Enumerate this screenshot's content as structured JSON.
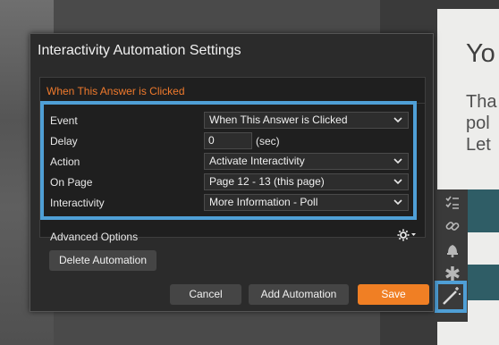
{
  "background": {
    "slide_heading": "Yo",
    "slide_body": [
      "Tha",
      "pol",
      "Let"
    ]
  },
  "dialog": {
    "title": "Interactivity Automation Settings",
    "panel_title": "When This Answer is Clicked",
    "fields": {
      "event": {
        "label": "Event",
        "value": "When This Answer is Clicked"
      },
      "delay": {
        "label": "Delay",
        "value": "0",
        "unit": "(sec)"
      },
      "action": {
        "label": "Action",
        "value": "Activate Interactivity"
      },
      "on_page": {
        "label": "On Page",
        "value": "Page 12 - 13 (this page)"
      },
      "interactivity": {
        "label": "Interactivity",
        "value": "More Information - Poll"
      }
    },
    "advanced_options_label": "Advanced Options",
    "buttons": {
      "delete": "Delete Automation",
      "cancel": "Cancel",
      "add": "Add Automation",
      "save": "Save"
    }
  },
  "colors": {
    "accent_orange": "#f07f24",
    "panel_title_orange": "#f07a2c",
    "highlight_blue": "#4f9fd6"
  },
  "icons": {
    "toolbar": [
      "checklist-icon",
      "link-icon",
      "bell-icon",
      "asterisk-icon",
      "magic-wand-icon"
    ],
    "gear": "gear-icon",
    "chevron": "chevron-down-icon"
  }
}
